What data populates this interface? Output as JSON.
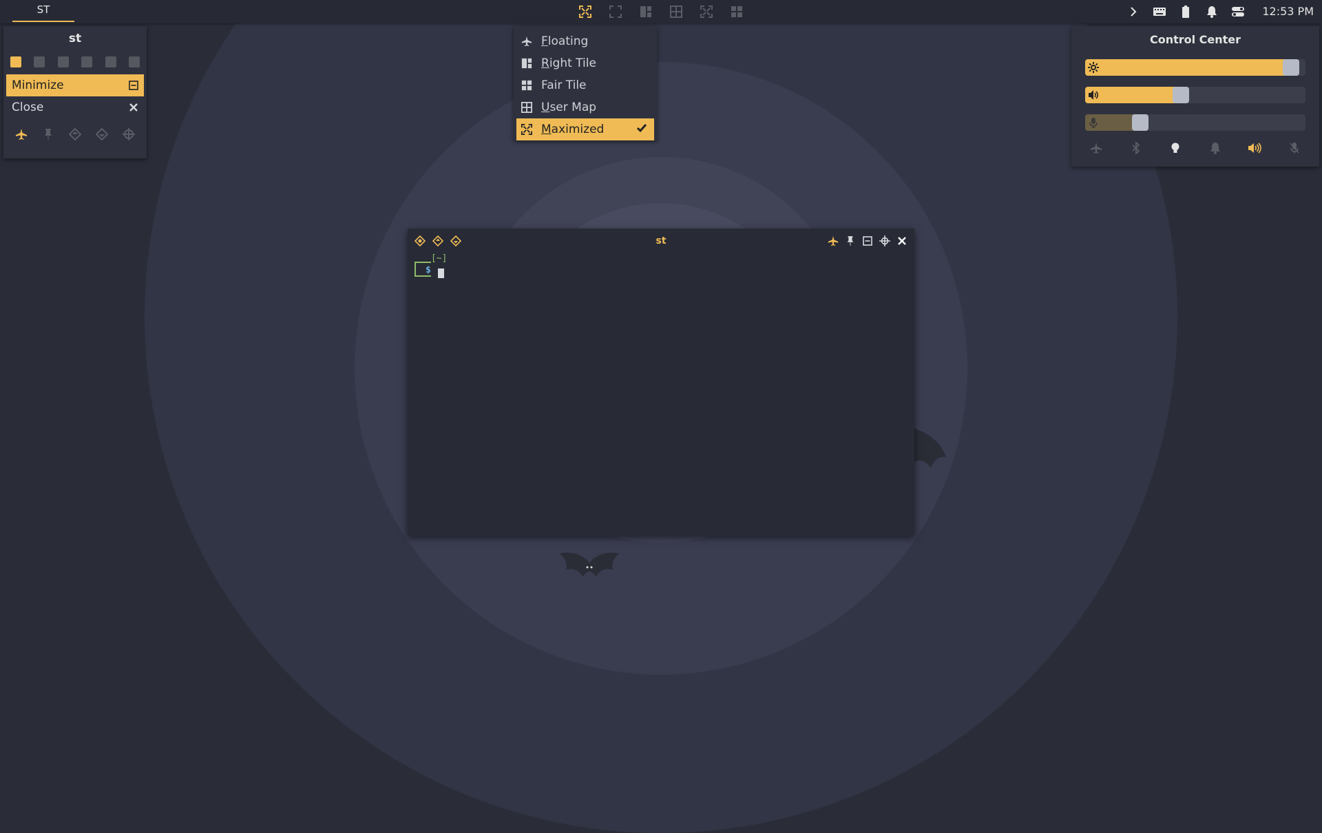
{
  "colors": {
    "accent": "#f0bb55",
    "panel": "#2f323e",
    "bar": "#272a34",
    "background": "#2a2d38",
    "inactive_icon": "#5a5d66"
  },
  "topbar": {
    "task_label": "ST",
    "layout_icons": [
      "maximized-layout-icon",
      "fullscreen-layout-icon",
      "right-tile-icon",
      "user-map-icon",
      "maximized-alt-icon",
      "fair-tile-icon"
    ],
    "tray_icons": [
      "chevron-right-icon",
      "keyboard-icon",
      "battery-icon",
      "bell-icon",
      "toggle-icon"
    ],
    "clock": "12:53 PM"
  },
  "client_menu": {
    "title": "st",
    "tags": 6,
    "active_tag": 0,
    "items": [
      {
        "label": "Minimize",
        "icon": "minimize-icon"
      },
      {
        "label": "Close",
        "icon": "close-icon"
      }
    ],
    "bottom_icons": [
      "floating-icon",
      "sticky-icon",
      "above-icon",
      "below-icon",
      "move-icon"
    ]
  },
  "layout_menu": {
    "items": [
      {
        "label": "Floating",
        "mnemonic": "F",
        "rest": "loating",
        "icon": "floating-icon"
      },
      {
        "label": "Right Tile",
        "mnemonic": "R",
        "rest": "ight Tile",
        "icon": "right-tile-icon"
      },
      {
        "label": "Fair Tile",
        "mnemonic": "",
        "rest": "Fair Tile",
        "icon": "fair-tile-icon"
      },
      {
        "label": "User Map",
        "mnemonic": "U",
        "rest": "ser Map",
        "icon": "user-map-icon"
      },
      {
        "label": "Maximized",
        "mnemonic": "M",
        "rest": "aximized",
        "icon": "maximized-icon",
        "selected": true
      }
    ]
  },
  "control_center": {
    "title": "Control Center",
    "brightness": 0.97,
    "volume": 0.43,
    "microphone": 0.23,
    "toggles": [
      "airplane-icon",
      "bluetooth-icon",
      "light-icon",
      "notification-icon",
      "volume-icon",
      "mic-off-icon"
    ]
  },
  "terminal": {
    "title": "st",
    "prompt_dir": "[~]",
    "prompt_symbol": "$"
  }
}
